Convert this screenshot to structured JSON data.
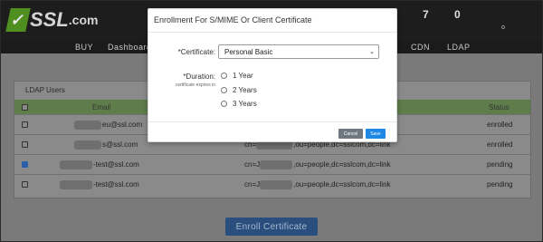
{
  "header": {
    "logo_text": "SSL",
    "logo_suffix": ".com",
    "stats": [
      {
        "value": "7"
      },
      {
        "value": "0"
      }
    ],
    "logout_dot": "o"
  },
  "nav": {
    "items": [
      "BUY",
      "Dashboard",
      "CDN",
      "LDAP"
    ]
  },
  "panel": {
    "title": "LDAP Users",
    "columns": {
      "email": "Email",
      "status": "Status"
    },
    "rows": [
      {
        "email": "eu@ssl.com",
        "dn_suffix": "link",
        "status": "enrolled",
        "checked": false
      },
      {
        "email": "s@ssl.com",
        "dn_prefix": "cn=",
        "dn_suffix": ",ou=people,dc=sslcom,dc=link",
        "status": "enrolled",
        "checked": false
      },
      {
        "email": "-test@ssl.com",
        "dn_prefix": "cn=J",
        "dn_suffix": ",ou=people,dc=sslcom,dc=link",
        "status": "pending",
        "checked": true
      },
      {
        "email": "-test@ssl.com",
        "dn_prefix": "cn=J",
        "dn_suffix": ",ou=people,dc=sslcom,dc=link",
        "status": "pending",
        "checked": false
      }
    ]
  },
  "enroll_button": "Enroll Certificate",
  "modal": {
    "title": "Enrollment For S/MIME Or Client Certificate",
    "certificate_label": "*Certificate:",
    "certificate_value": "Personal Basic",
    "duration_label": "*Duration:",
    "duration_sublabel": "certificate expires in",
    "duration_options": [
      "1 Year",
      "2 Years",
      "3 Years"
    ],
    "cancel_label": "Cancel",
    "save_label": "Save"
  },
  "colors": {
    "accent": "#1e88e5",
    "logo_green": "#4f8f1f",
    "table_header": "#5f7d4a",
    "enroll_button": "#2a4f7e"
  }
}
